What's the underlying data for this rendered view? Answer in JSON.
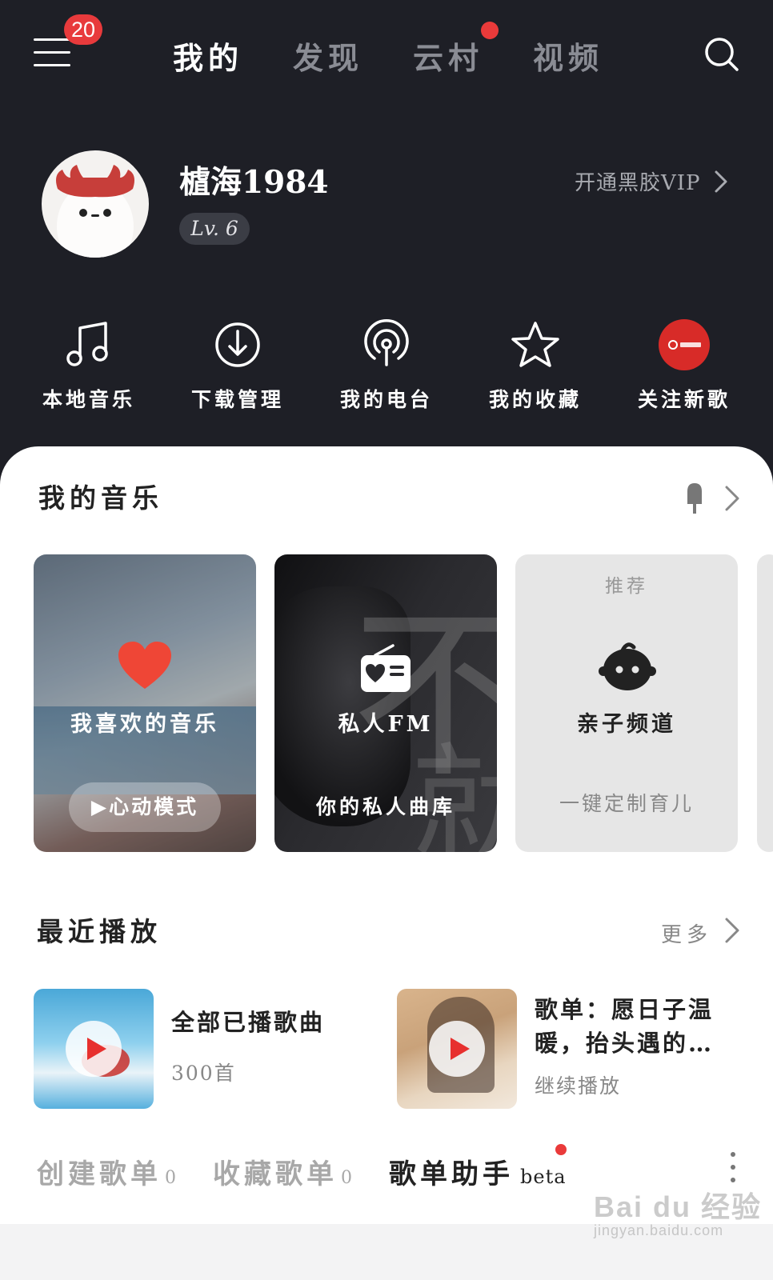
{
  "header": {
    "notification_count": "20",
    "tabs": [
      {
        "label": "我的",
        "active": true
      },
      {
        "label": "发现",
        "active": false
      },
      {
        "label": "云村",
        "active": false,
        "has_dot": true
      },
      {
        "label": "视频",
        "active": false
      }
    ],
    "icons": {
      "menu": "hamburger-menu-icon",
      "search": "search-icon"
    }
  },
  "profile": {
    "username": "樝海1984",
    "level": "Lv. 6",
    "vip_link": "开通黑胶VIP"
  },
  "quick_actions": [
    {
      "label": "本地音乐",
      "icon": "music-note-icon"
    },
    {
      "label": "下载管理",
      "icon": "download-icon"
    },
    {
      "label": "我的电台",
      "icon": "podcast-icon"
    },
    {
      "label": "我的收藏",
      "icon": "star-icon"
    },
    {
      "label": "关注新歌",
      "icon": "netease-logo-icon"
    }
  ],
  "my_music": {
    "title": "我的音乐",
    "cards": [
      {
        "label": "我喜欢的音乐",
        "button": "心动模式"
      },
      {
        "label": "私人FM",
        "subtitle": "你的私人曲库"
      },
      {
        "tag": "推荐",
        "label": "亲子频道",
        "subtitle": "一键定制育儿"
      }
    ]
  },
  "recent": {
    "title": "最近播放",
    "more": "更多",
    "items": [
      {
        "title": "全部已播歌曲",
        "subtitle": "300首"
      },
      {
        "title_line1": "歌单：愿日子温",
        "title_line2": "暖，抬头遇的…",
        "subtitle": "继续播放"
      }
    ]
  },
  "playlist_tabs": [
    {
      "label": "创建歌单",
      "count": "0"
    },
    {
      "label": "收藏歌单",
      "count": "0"
    },
    {
      "label": "歌单助手",
      "suffix": "beta"
    }
  ],
  "watermark": {
    "main": "Bai du 经验",
    "url": "jingyan.baidu.com"
  },
  "colors": {
    "accent": "#e83a3c",
    "dark_bg": "#1e1f26",
    "panel_bg": "#ffffff"
  }
}
